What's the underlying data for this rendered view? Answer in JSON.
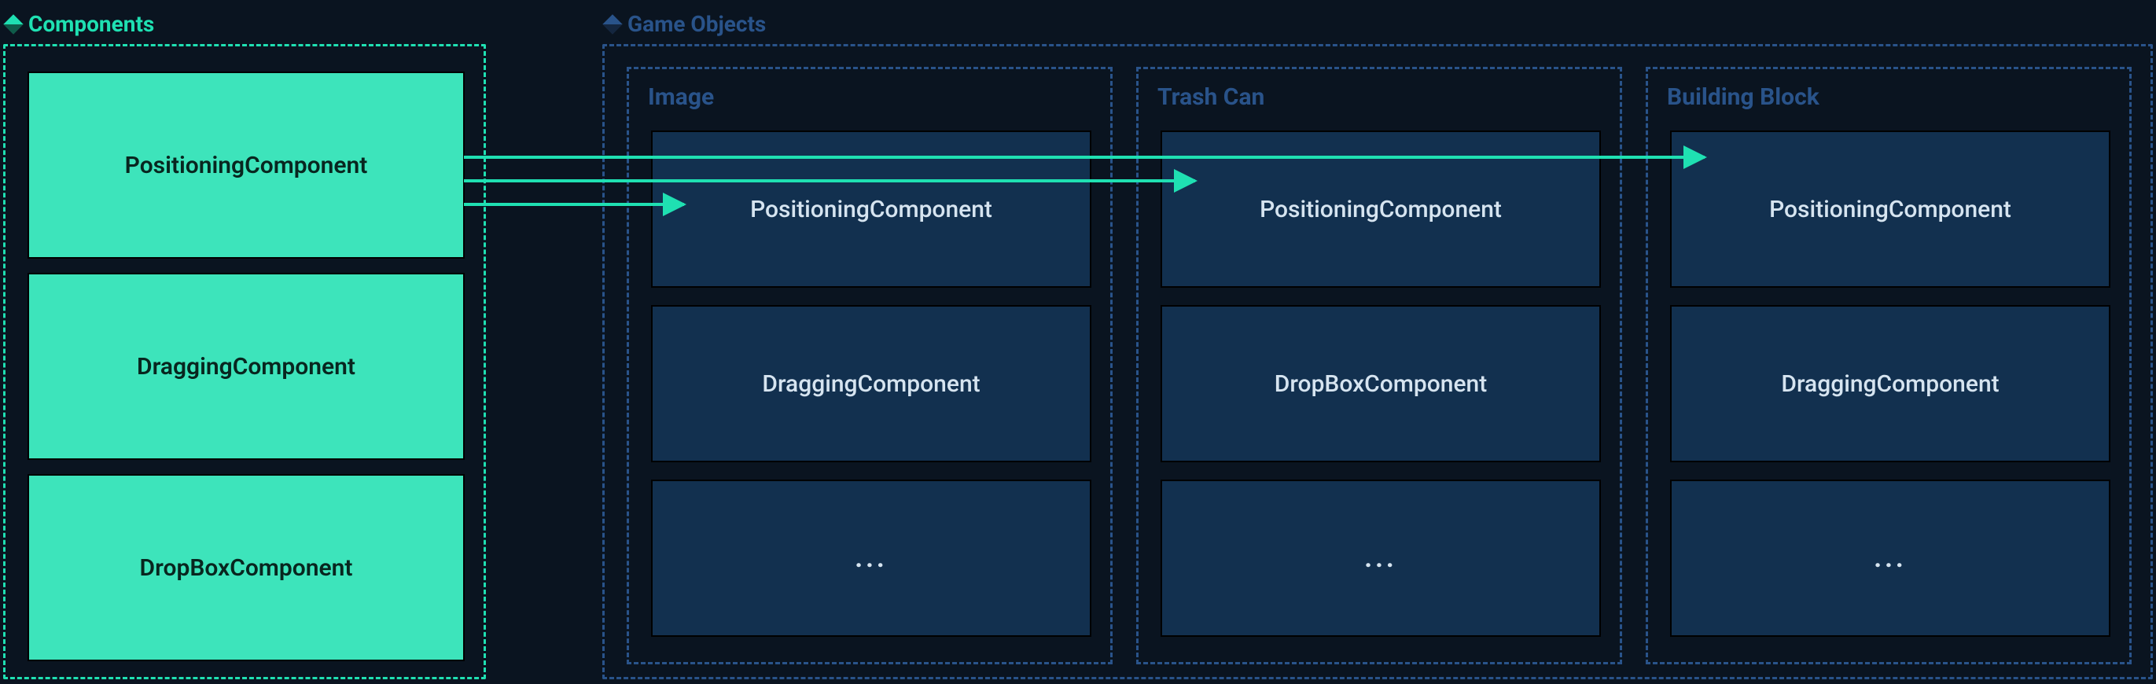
{
  "headers": {
    "components": "Components",
    "game_objects": "Game Objects"
  },
  "components_panel": {
    "items": [
      "PositioningComponent",
      "DraggingComponent",
      "DropBoxComponent"
    ]
  },
  "game_objects": [
    {
      "title": "Image",
      "slots": [
        "PositioningComponent",
        "DraggingComponent",
        "..."
      ]
    },
    {
      "title": "Trash Can",
      "slots": [
        "PositioningComponent",
        "DropBoxComponent",
        "..."
      ]
    },
    {
      "title": "Building Block",
      "slots": [
        "PositioningComponent",
        "DraggingComponent",
        "..."
      ]
    }
  ],
  "colors": {
    "teal": "#1fe0b2",
    "navy_border": "#29538a",
    "slot_bg": "#12304f",
    "bg": "#0a1420"
  }
}
